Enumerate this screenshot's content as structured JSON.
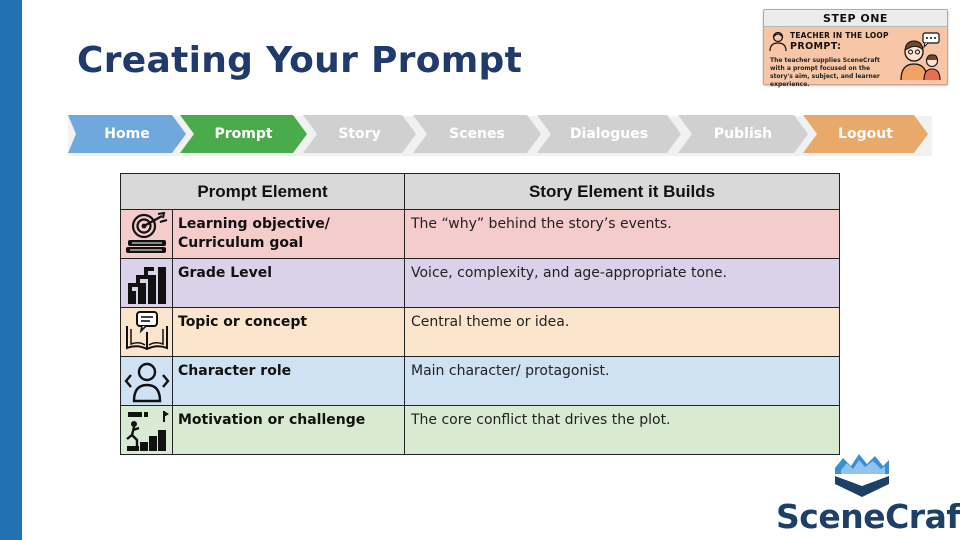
{
  "page": {
    "title": "Creating Your Prompt"
  },
  "step_card": {
    "header": "STEP ONE",
    "subtitle_line1": "TEACHER IN THE LOOP",
    "subtitle_line2": "PROMPT:",
    "description": "The teacher supplies SceneCraft with a prompt focused on the story's aim, subject, and learner experience."
  },
  "nav": {
    "items": [
      {
        "label": "Home",
        "color": "#6fa8dc"
      },
      {
        "label": "Prompt",
        "color": "#4aab4a"
      },
      {
        "label": "Story",
        "color": "#d0d0d0"
      },
      {
        "label": "Scenes",
        "color": "#d0d0d0"
      },
      {
        "label": "Dialogues",
        "color": "#d0d0d0"
      },
      {
        "label": "Publish",
        "color": "#d0d0d0"
      },
      {
        "label": "Logout",
        "color": "#e8a96a"
      }
    ]
  },
  "table": {
    "headers": [
      "Prompt Element",
      "Story Element it Builds"
    ],
    "rows": [
      {
        "icon": "target-books-icon",
        "element": "Learning objective/ Curriculum goal",
        "builds": "The “why” behind the story’s events.",
        "color": "#f4cccc"
      },
      {
        "icon": "stairs-bars-icon",
        "element": "Grade Level",
        "builds": "Voice, complexity, and age-appropriate tone.",
        "color": "#d9d2e9"
      },
      {
        "icon": "book-chat-icon",
        "element": "Topic or concept",
        "builds": "Central theme or idea.",
        "color": "#fce5cd"
      },
      {
        "icon": "person-arrows-icon",
        "element": "Character role",
        "builds": "Main character/ protagonist.",
        "color": "#cfe2f3"
      },
      {
        "icon": "climbing-steps-icon",
        "element": "Motivation or challenge",
        "builds": "The core conflict that drives the plot.",
        "color": "#d9ead3"
      }
    ]
  },
  "logo": {
    "text": "SceneCraft"
  }
}
